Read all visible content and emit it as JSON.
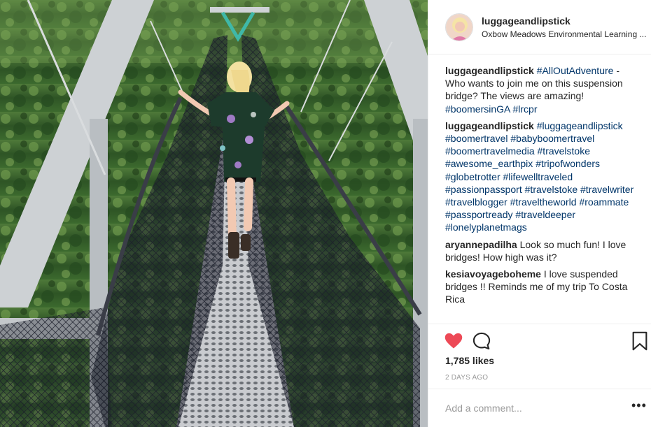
{
  "post": {
    "username": "luggageandlipstick",
    "location": "Oxbow Meadows Environmental Learning ...",
    "photo_icon": "suspension-bridge-photo"
  },
  "caption": {
    "author": "luggageandlipstick",
    "hashtag_1": "#AllOutAdventure",
    "text": " - Who wants to join me on this suspension bridge? The views are amazing! ",
    "hashtag_2": "#boomersinGA",
    "hashtag_3": "#lrcpr"
  },
  "hashtag_comment": {
    "author": "luggageandlipstick",
    "tags": [
      "#luggageandlipstick",
      "#boomertravel",
      "#babyboomertravel",
      "#boomertravelmedia",
      "#travelstoke",
      "#awesome_earthpix",
      "#tripofwonders",
      "#globetrotter",
      "#lifewelltraveled",
      "#passionpassport",
      "#travelstoke",
      "#travelwriter",
      "#travelblogger",
      "#traveltheworld",
      "#roammate",
      "#passportready",
      "#traveldeeper",
      "#lonelyplanetmags"
    ]
  },
  "comments": [
    {
      "author": "aryannepadilha",
      "text": "Look so much fun! I love bridges! How high was it?"
    },
    {
      "author": "kesiavoyageboheme",
      "text": "I love suspended bridges !! Reminds me of my trip To Costa Rica"
    }
  ],
  "actions": {
    "like_icon": "heart-icon",
    "comment_icon": "comment-bubble-icon",
    "save_icon": "bookmark-icon",
    "like_color": "#ed4956"
  },
  "likes": "1,785 likes",
  "timestamp": "2 DAYS AGO",
  "add_comment": {
    "placeholder": "Add a comment...",
    "more_label": "•••"
  }
}
